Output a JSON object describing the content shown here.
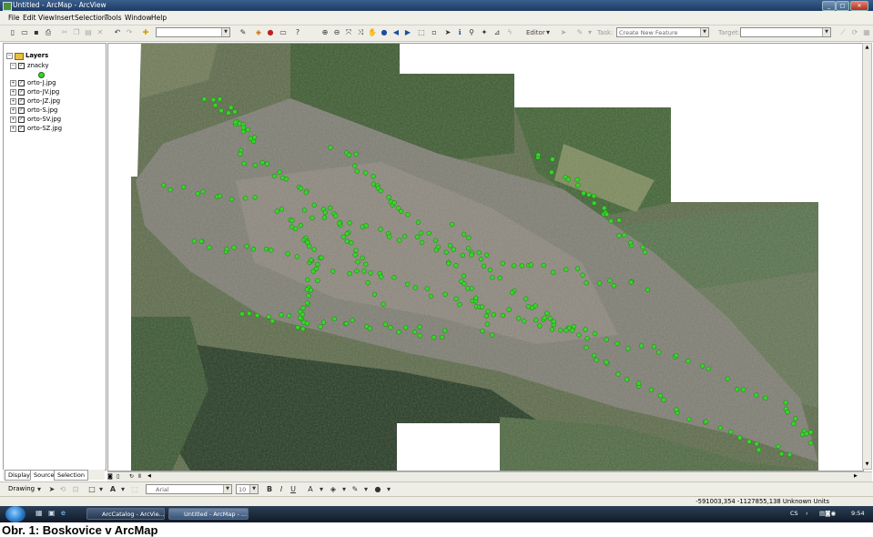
{
  "window": {
    "title": "Untitled - ArcMap - ArcView"
  },
  "menu": [
    "File",
    "Edit",
    "View",
    "Insert",
    "Selection",
    "Tools",
    "Window",
    "Help"
  ],
  "toolbar": {
    "scale_value": "",
    "editor_label": "Editor",
    "task_label": "Task:",
    "task_value": "Create New Feature",
    "target_label": "Target:",
    "target_value": ""
  },
  "toc": {
    "root": "Layers",
    "layers": [
      {
        "name": "znacky",
        "expanded": true,
        "checked": true
      },
      {
        "name": "orto-J.jpg",
        "expanded": false,
        "checked": true
      },
      {
        "name": "orto-JV.jpg",
        "expanded": false,
        "checked": true
      },
      {
        "name": "orto-JZ.jpg",
        "expanded": false,
        "checked": true
      },
      {
        "name": "orto-S.jpg",
        "expanded": false,
        "checked": true
      },
      {
        "name": "orto-SV.jpg",
        "expanded": false,
        "checked": true
      },
      {
        "name": "orto-SZ.jpg",
        "expanded": false,
        "checked": true
      }
    ],
    "tabs": [
      "Display",
      "Source",
      "Selection"
    ]
  },
  "drawing": {
    "label": "Drawing",
    "font": "Arial",
    "size": "10",
    "bold": "B",
    "italic": "I",
    "underline": "U",
    "text_tool": "A"
  },
  "status": {
    "coords": "-591003,354  -1127855,138 Unknown Units"
  },
  "taskbar": {
    "buttons": [
      "ArcCatalog - ArcVie...",
      "Untitled - ArcMap - ..."
    ],
    "lang": "CS",
    "time": "9:54"
  },
  "caption": "Obr. 1: Boskovice v ArcMap",
  "colors": {
    "point": "#37d629",
    "title_bar": "#1d3a63"
  }
}
